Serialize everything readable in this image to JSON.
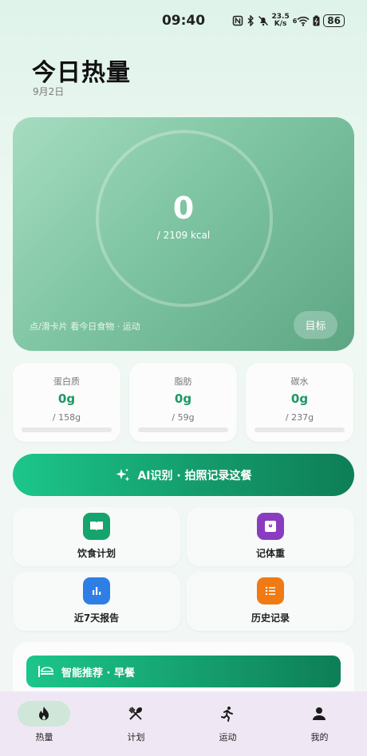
{
  "status_bar": {
    "time": "09:40",
    "net_speed": "23.5",
    "net_unit": "K/s",
    "signal_gen": "6",
    "battery": "86",
    "icons": [
      "nfc-icon",
      "bluetooth-icon",
      "mute-icon",
      "wifi-icon",
      "battery-saver-icon",
      "battery-icon"
    ]
  },
  "header": {
    "title": "今日热量",
    "date": "9月2日"
  },
  "summary": {
    "calories": "0",
    "goal_text": "/ 2109 kcal",
    "hint": "点/滑卡片 看今日食物 · 运动",
    "goal_button": "目标",
    "progress": 0
  },
  "macros": [
    {
      "label": "蛋白质",
      "value": "0g",
      "goal": "/ 158g",
      "progress": 0
    },
    {
      "label": "脂肪",
      "value": "0g",
      "goal": "/ 59g",
      "progress": 0
    },
    {
      "label": "碳水",
      "value": "0g",
      "goal": "/ 237g",
      "progress": 0
    }
  ],
  "ai_button": {
    "label": "AI识别 · 拍照记录这餐",
    "icon": "sparkle-icon"
  },
  "tiles": [
    {
      "label": "饮食计划",
      "icon": "book-icon",
      "color": "#17a36e"
    },
    {
      "label": "记体重",
      "icon": "scale-icon",
      "color": "#8a3cc0"
    },
    {
      "label": "近7天报告",
      "icon": "bar-chart-icon",
      "color": "#2f7ee6"
    },
    {
      "label": "历史记录",
      "icon": "list-icon",
      "color": "#f07a14"
    }
  ],
  "recommend": {
    "label": "智能推荐 · 早餐",
    "icon": "breakfast-icon"
  },
  "nav": [
    {
      "label": "热量",
      "icon": "flame-icon",
      "active": true
    },
    {
      "label": "计划",
      "icon": "utensils-icon",
      "active": false
    },
    {
      "label": "运动",
      "icon": "running-icon",
      "active": false
    },
    {
      "label": "我的",
      "icon": "person-icon",
      "active": false
    }
  ],
  "colors": {
    "accent": "#1c9866",
    "nav_bg": "#efe8f4",
    "active_pill": "#cfe6d9"
  }
}
